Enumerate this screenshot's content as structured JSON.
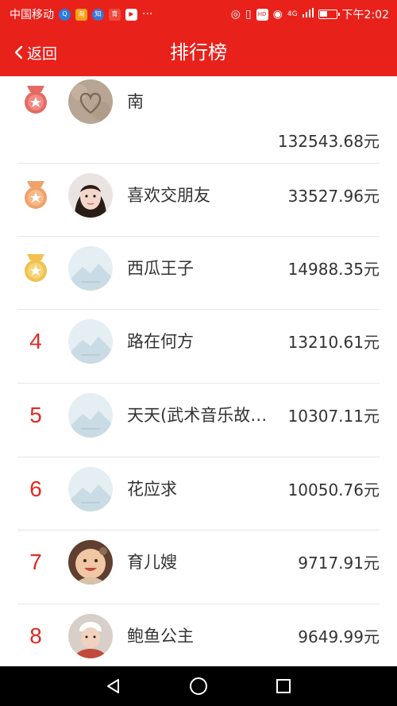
{
  "status_bar": {
    "carrier": "中国移动",
    "time": "下午2:02",
    "network": "4G"
  },
  "header": {
    "back_label": "返回",
    "title": "排行榜"
  },
  "colors": {
    "brand_red": "#e8211b",
    "rank_red": "#e02a22"
  },
  "ranking": [
    {
      "rank": "1",
      "medal": "red-medal-icon",
      "name": "南",
      "amount": "132543.68元"
    },
    {
      "rank": "2",
      "medal": "orange-medal-icon",
      "name": "喜欢交朋友",
      "amount": "33527.96元"
    },
    {
      "rank": "3",
      "medal": "gold-medal-icon",
      "name": "西瓜王子",
      "amount": "14988.35元"
    },
    {
      "rank": "4",
      "name": "路在何方",
      "amount": "13210.61元"
    },
    {
      "rank": "5",
      "name": "天天(武术音乐故…",
      "amount": "10307.11元"
    },
    {
      "rank": "6",
      "name": "花应求",
      "amount": "10050.76元"
    },
    {
      "rank": "7",
      "name": "育儿嫂",
      "amount": "9717.91元"
    },
    {
      "rank": "8",
      "name": "鲍鱼公主",
      "amount": "9649.99元"
    }
  ]
}
